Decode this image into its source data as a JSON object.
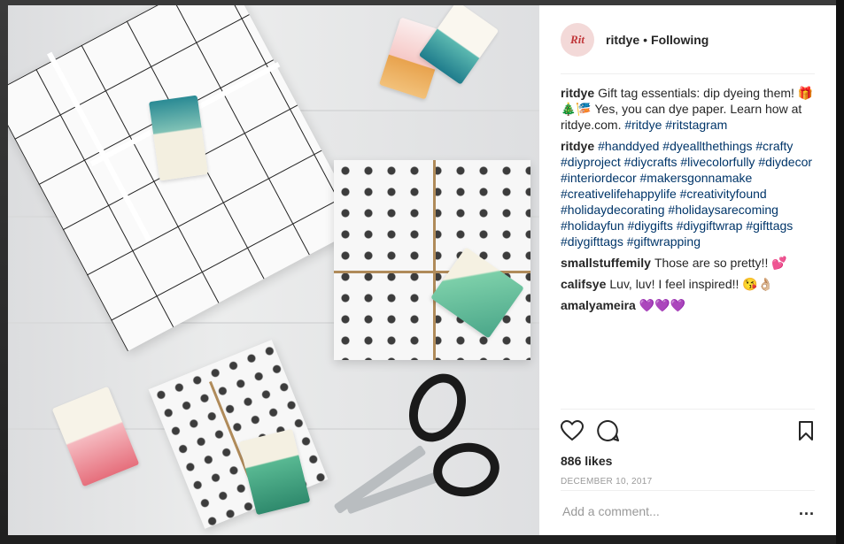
{
  "post": {
    "avatar_text": "Rit",
    "username": "ritdye",
    "separator": "•",
    "follow_status": "Following"
  },
  "comments": [
    {
      "user": "ritdye",
      "text": "Gift tag essentials: dip dyeing them! 🎁🎄🎏 Yes, you can dye paper. Learn how at ritdye.com.",
      "tags": "#ritdye #ritstagram"
    },
    {
      "user": "ritdye",
      "text": "",
      "tags": "#handdyed #dyeallthethings #crafty #diyproject #diycrafts #livecolorfully #diydecor #interiordecor #makersgonnamake #creativelifehappylife #creativityfound #holidaydecorating #holidaysarecoming #holidayfun #diygifts #diygiftwrap #gifttags #diygifttags #giftwrapping"
    },
    {
      "user": "smallstuffemily",
      "text": "Those are so pretty!! 💕",
      "tags": ""
    },
    {
      "user": "califsye",
      "text": "Luv, luv! I feel inspired!! 😘👌🏼",
      "tags": ""
    },
    {
      "user": "amalyameira",
      "text": "💜💜💜",
      "tags": ""
    }
  ],
  "actions": {
    "icons": [
      "heart-icon",
      "comment-icon",
      "bookmark-icon"
    ],
    "likes": "886 likes",
    "date": "December 10, 2017"
  },
  "compose": {
    "placeholder": "Add a comment...",
    "more": "..."
  }
}
